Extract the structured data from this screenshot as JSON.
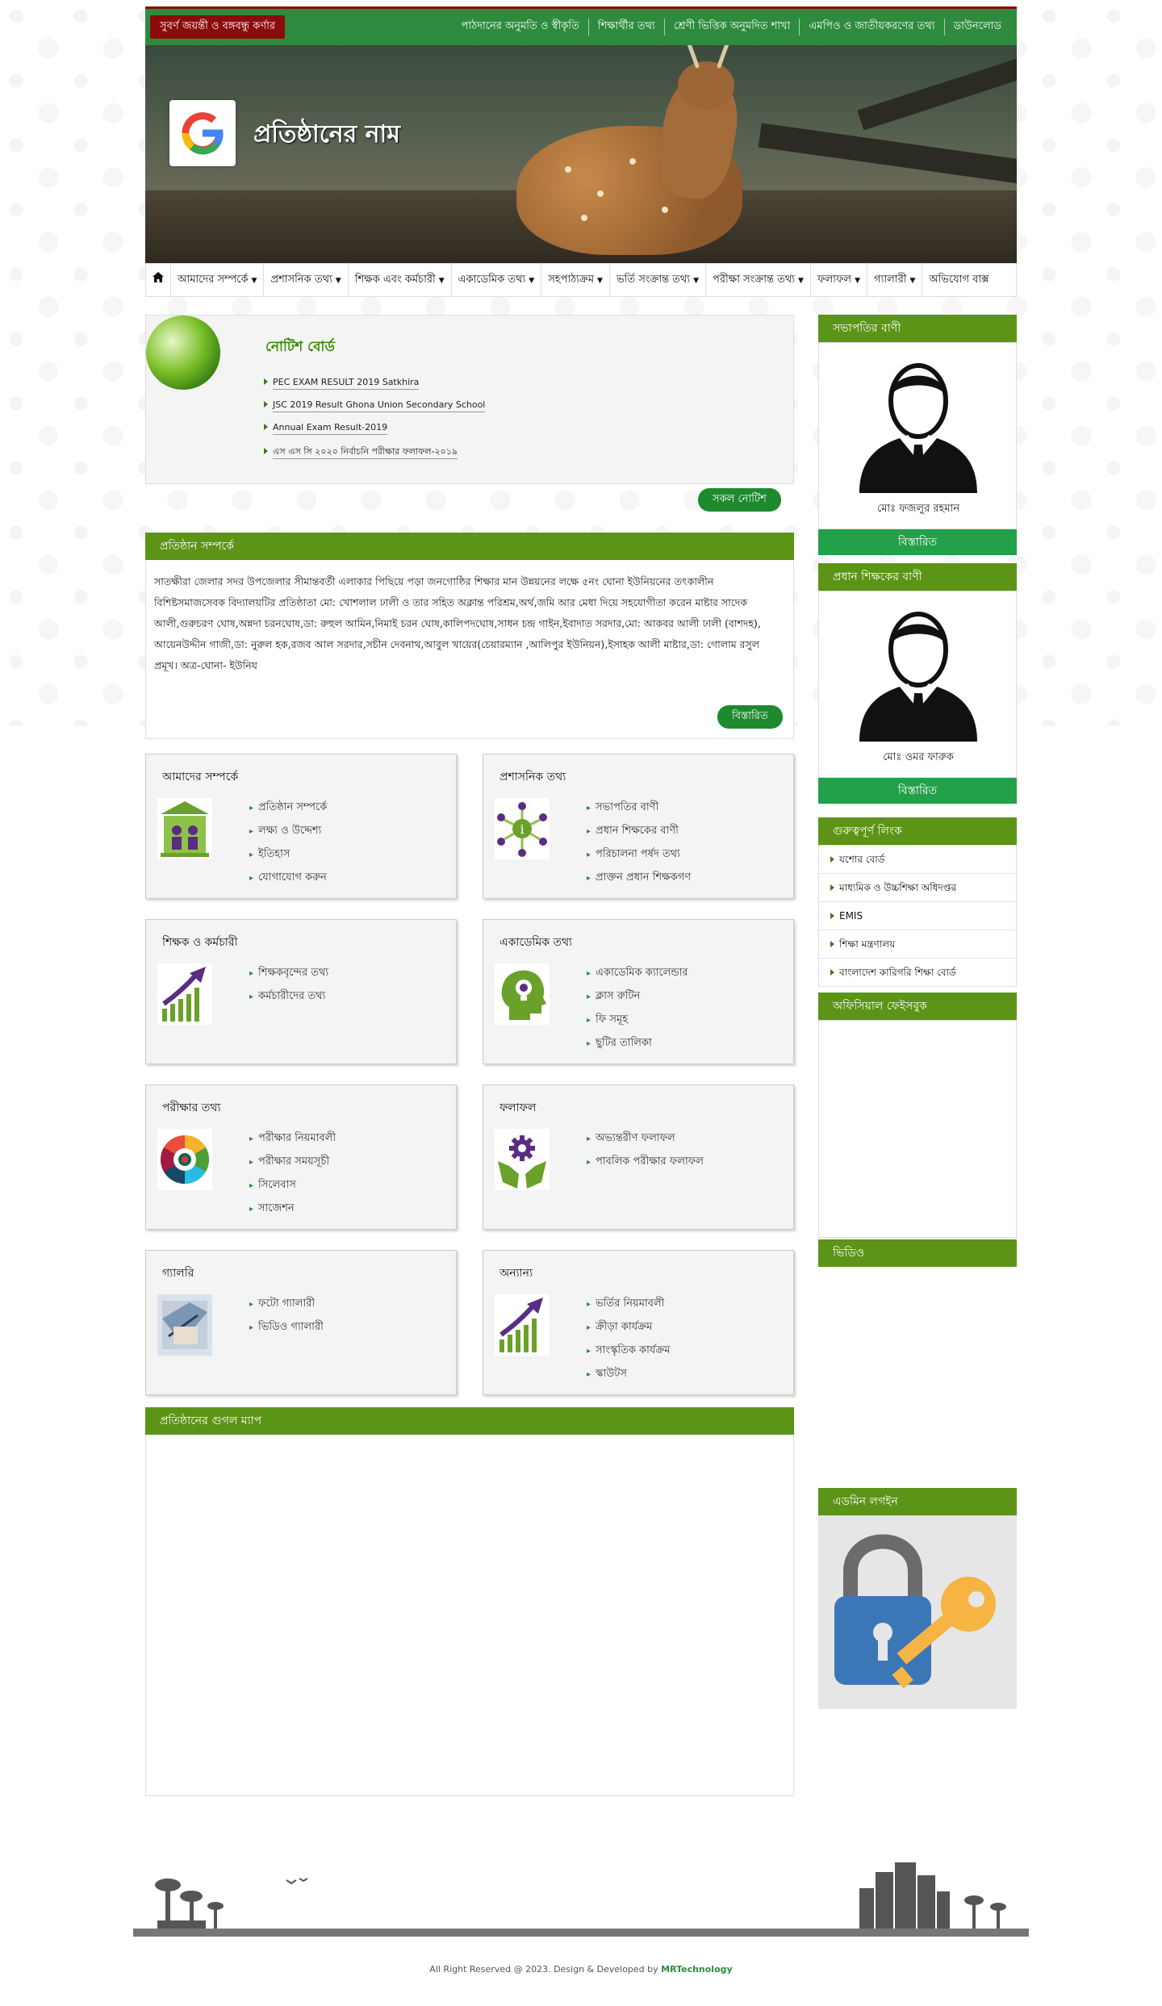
{
  "topbar": {
    "badge": "সুবর্ণ জয়ন্তী ও বঙ্গবন্ধু কর্ণার",
    "links": [
      "পাঠদানের অনুমতি ও স্বীকৃতি",
      "শিক্ষার্থীর তথ্য",
      "শ্রেণী ভিত্তিক অনুমদিত শাখা",
      "এমপিও ও জাতীয়করণের তথ্য",
      "ডাউনলোড"
    ]
  },
  "header": {
    "school_name": "প্রতিষ্ঠানের নাম"
  },
  "nav": {
    "home_icon": "home-icon",
    "items": [
      "আমাদের সম্পর্কে",
      "প্রশাসনিক তথ্য",
      "শিক্ষক এবং কর্মচারী",
      "একাডেমিক তথ্য",
      "সহপাঠ্যক্রম",
      "ভর্তি সংক্রান্ত তথ্য",
      "পরীক্ষা সংক্রান্ত তথ্য",
      "ফলাফল",
      "গ্যালারী",
      "অভিযোগ বাক্স"
    ]
  },
  "notice": {
    "title": "নোটিশ বোর্ড",
    "items": [
      "PEC EXAM RESULT 2019 Satkhira",
      "JSC 2019 Result Ghona Union Secondary School",
      "Annual Exam Result-2019",
      "এস এস সি ২০২০ নির্বাচনি পরীক্ষার ফলাফল-২০১৯"
    ],
    "all_button": "সকল নোটিশ"
  },
  "about": {
    "heading": "প্রতিষ্ঠান সম্পর্কে",
    "text": "সাতক্ষীরা জেলার সদর উপজেলার সীমান্তবর্তী এলাকার পিছিয়ে পড়া জনগোষ্ঠির শিক্ষার মান উন্নয়নের লক্ষে ৫নং ঘোনা ইউনিয়নের তৎকালীন বিশিষ্টসমাজসেবক বিদ্যালয়টির প্রতিষ্ঠাতা মো: খোশলাল ঢালী ও তার সহিত অক্লান্ত পরিশ্রম,অর্থ,জমি আর মেধা দিয়ে সহযোগীতা করেন মাষ্টার সাদেক আলী,গুরুচরণ ঘোষ,অন্নদা চরনঘোষ,ডা: রুহুল আমিন,নিমাই চরন ঘোষ,কালিপদঘোষ,সাধন চন্দ্র গাইন,ইবাদাত সরদার,মো: আকবর আলী ঢালী (বাশদহ), আয়েনউদ্দীন গাজী,ডা: নুরুল হক,রজব আল সরদার,সচীন দেবনাথ,আবুল খায়ের(চেয়ারম্যান ,আলিপুর ইউনিয়ন),ইসাহক আলী মাষ্টার,ডা: গোলাম রসুল প্রমূখ। অত্র-ঘোনা- ইউনিয",
    "more_button": "বিস্তারিত"
  },
  "cards": [
    {
      "title": "আমাদের সম্পর্কে",
      "icon": "institution-icon",
      "links": [
        "প্রতিষ্ঠান সম্পর্কে",
        "লক্ষ্য ও উদ্দেশ্য",
        "ইতিহাস",
        "যোগাযোগ করুন"
      ]
    },
    {
      "title": "প্রশাসনিক তথ্য",
      "icon": "network-info-icon",
      "links": [
        "সভাপতির বাণী",
        "প্রধান শিক্ষকের বাণী",
        "পরিচালনা পর্ষদ তথ্য",
        "প্রাক্তন প্রধান শিক্ষকগণ"
      ]
    },
    {
      "title": "শিক্ষক ও কর্মচারী",
      "icon": "growth-chart-icon",
      "links": [
        "শিক্ষকবৃন্দের তথ্য",
        "কর্মচারীদের তথ্য"
      ]
    },
    {
      "title": "একাডেমিক তথ্য",
      "icon": "idea-head-icon",
      "links": [
        "একাডেমিক ক্যালেন্ডার",
        "ক্লাস রুটিন",
        "ফি সমূহ",
        "ছুটির তালিকা"
      ]
    },
    {
      "title": "পরীক্ষার তথ্য",
      "icon": "exam-wheel-icon",
      "links": [
        "পরীক্ষার নিয়মাবলী",
        "পরীক্ষার সময়সূচী",
        "সিলেবাস",
        "সাজেশন"
      ]
    },
    {
      "title": "ফলাফল",
      "icon": "hands-gear-icon",
      "links": [
        "অভ্যন্তরীণ ফলাফল",
        "পাবলিক পরীক্ষার ফলাফল"
      ]
    },
    {
      "title": "গ্যালরি",
      "icon": "gallery-photo-icon",
      "links": [
        "ফটো গ্যালারী",
        "ভিডিও গ্যালারী"
      ]
    },
    {
      "title": "অন্যান্য",
      "icon": "growth-chart-icon",
      "links": [
        "ভর্তির নিয়মাবলী",
        "ক্রীড়া কার্যক্রম",
        "সাংস্কৃতিক কার্যক্রম",
        "স্কাউটস"
      ]
    }
  ],
  "map": {
    "heading": "প্রতিষ্ঠানের গুগল ম্যাপ"
  },
  "sidebar": {
    "chairman": {
      "heading": "সভাপতির বাণী",
      "name": "মোঃ ফজলুর রহমান",
      "button": "বিস্তারিত"
    },
    "headmaster": {
      "heading": "প্রধান শিক্ষকের বাণী",
      "name": "মোঃ ওমর ফারুক",
      "button": "বিস্তারিত"
    },
    "links": {
      "heading": "গুরুত্বপূর্ণ লিংক",
      "items": [
        "যশোর বোর্ড",
        "মাধ্যমিক ও উচ্চশিক্ষা অধিদপ্তর",
        "EMIS",
        "শিক্ষা মন্ত্রণালয়",
        "বাংলাদেশ কারিগরি শিক্ষা বোর্ড"
      ]
    },
    "facebook": {
      "heading": "অফিসিয়াল ফেইসবুক"
    },
    "video": {
      "heading": "ভিডিও"
    },
    "admin": {
      "heading": "এডমিন লগইন"
    }
  },
  "footer": {
    "copyright": "All Right Reserved @ 2023. Design & Developed by ",
    "developer": "MRTechnology"
  }
}
